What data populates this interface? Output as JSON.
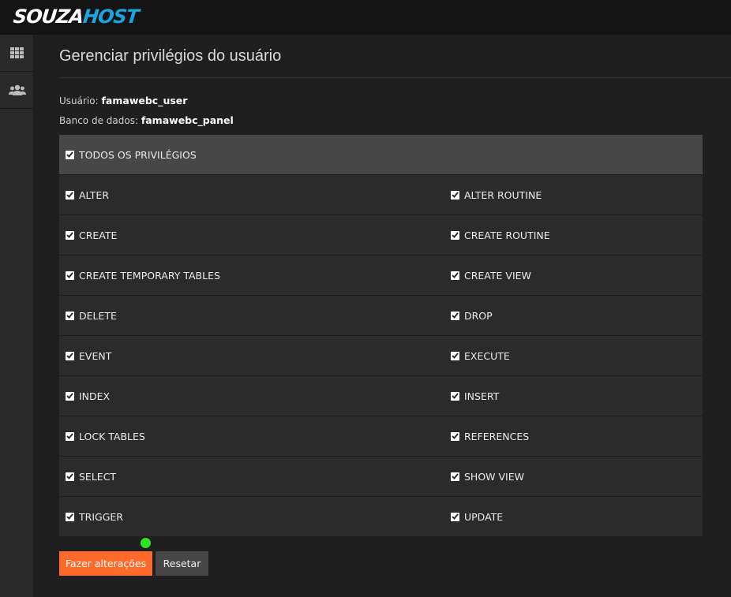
{
  "app": {
    "logo_part1": "SOUZA",
    "logo_part2": "HOST",
    "brand_colors": {
      "primary": "#ff6a2b",
      "logo_accent": "#1aa4e0"
    }
  },
  "sidebar": {
    "items": [
      {
        "icon": "grid-icon"
      },
      {
        "icon": "users-icon"
      }
    ]
  },
  "page": {
    "title": "Gerenciar privilégios do usuário",
    "user_label": "Usuário:",
    "user_value": "famawebc_user",
    "db_label": "Banco de dados:",
    "db_value": "famawebc_panel"
  },
  "privileges": {
    "all_label": "TODOS OS PRIVILÉGIOS",
    "all_checked": true,
    "rows": [
      {
        "left": "ALTER",
        "right": "ALTER ROUTINE"
      },
      {
        "left": "CREATE",
        "right": "CREATE ROUTINE"
      },
      {
        "left": "CREATE TEMPORARY TABLES",
        "right": "CREATE VIEW"
      },
      {
        "left": "DELETE",
        "right": "DROP"
      },
      {
        "left": "EVENT",
        "right": "EXECUTE"
      },
      {
        "left": "INDEX",
        "right": "INSERT"
      },
      {
        "left": "LOCK TABLES",
        "right": "REFERENCES"
      },
      {
        "left": "SELECT",
        "right": "SHOW VIEW"
      },
      {
        "left": "TRIGGER",
        "right": "UPDATE"
      }
    ]
  },
  "actions": {
    "submit_label": "Fazer alterações",
    "reset_label": "Resetar"
  }
}
